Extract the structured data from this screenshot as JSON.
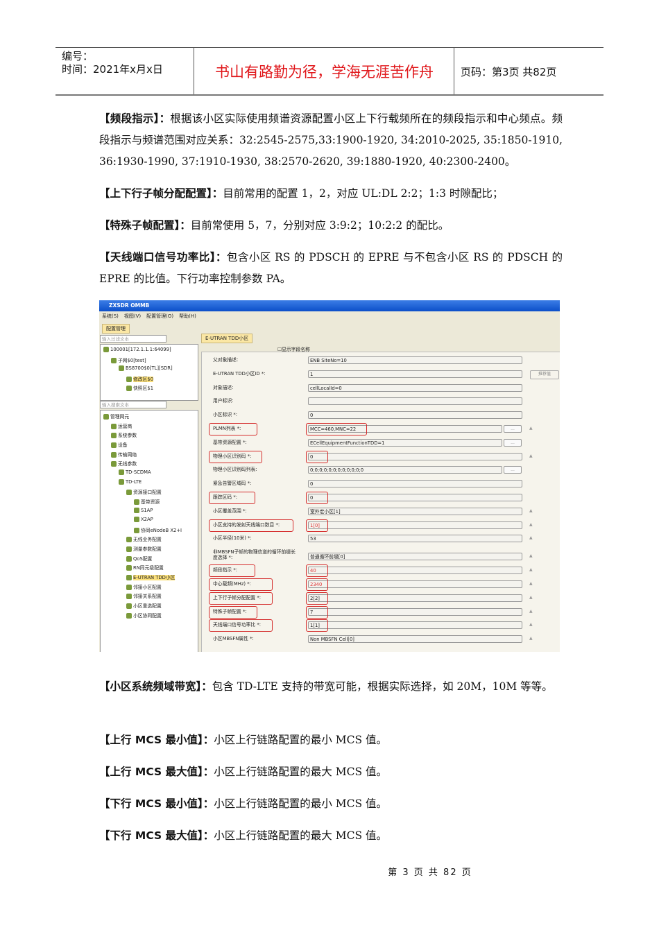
{
  "header": {
    "number_label": "编号：",
    "time_label": "时间：2021年x月x日",
    "motto": "书山有路勤为径，学海无涯苦作舟",
    "page_label": "页码：第3页 共82页"
  },
  "paragraphs": [
    {
      "title": "【频段指示】：",
      "body": "根据该小区实际使用频谱资源配置小区上下行载频所在的频段指示和中心频点。频段指示与频谱范围对应关系：32:2545-2575,33:1900-1920, 34:2010-2025, 35:1850-1910, 36:1930-1990, 37:1910-1930, 38:2570-2620, 39:1880-1920, 40:2300-2400。"
    },
    {
      "title": "【上下行子帧分配配置】：",
      "body": "目前常用的配置 1，2，对应 UL:DL 2:2；1:3 时隙配比；"
    },
    {
      "title": "【特殊子帧配置】：",
      "body": "目前常使用 5，7，分别对应 3:9:2；10:2:2 的配比。"
    },
    {
      "title": "【天线端口信号功率比】：",
      "body": "包含小区 RS 的 PDSCH 的 EPRE 与不包含小区 RS 的 PDSCH 的 EPRE 的比值。下行功率控制参数 PA。"
    },
    {
      "title": "【小区系统频域带宽】：",
      "body": "包含 TD-LTE 支持的带宽可能，根据实际选择，如 20M，10M 等等。"
    },
    {
      "title": "【上行 MCS 最小值】：",
      "body": "小区上行链路配置的最小 MCS 值。"
    },
    {
      "title": "【上行 MCS 最大值】：",
      "body": "小区上行链路配置的最大 MCS 值。"
    },
    {
      "title": "【下行 MCS 最小值】：",
      "body": "小区上行链路配置的最小 MCS 值。"
    },
    {
      "title": "【下行 MCS 最大值】：",
      "body": "小区上行链路配置的最大 MCS 值。"
    }
  ],
  "footer": "第 3 页 共 82 页",
  "screenshot": {
    "window_title": "ZXSDR OMMB",
    "menu": [
      "系统(S)",
      "视图(V)",
      "配置管理(O)",
      "帮助(H)"
    ],
    "left_tab": "配置管理",
    "filter_placeholder": "输入过滤文本",
    "search_placeholder": "输入搜索文本",
    "top_tree": [
      {
        "label": "100001[172.1.1.1:64099]",
        "indent": 0
      },
      {
        "label": "子网$0[test]",
        "indent": 1
      },
      {
        "label": "BS8700$0[TL][SDR]",
        "indent": 2
      },
      {
        "label": "修改区$0",
        "indent": 3,
        "selected": true
      },
      {
        "label": "快照区$1",
        "indent": 3
      }
    ],
    "bottom_tree": [
      {
        "label": "管理网元",
        "indent": 0
      },
      {
        "label": "运营商",
        "indent": 1
      },
      {
        "label": "系统参数",
        "indent": 1
      },
      {
        "label": "设备",
        "indent": 1
      },
      {
        "label": "传输网络",
        "indent": 1
      },
      {
        "label": "无线参数",
        "indent": 1
      },
      {
        "label": "TD-SCDMA",
        "indent": 2
      },
      {
        "label": "TD-LTE",
        "indent": 2
      },
      {
        "label": "资源接口配置",
        "indent": 3
      },
      {
        "label": "基带资源",
        "indent": 4
      },
      {
        "label": "S1AP",
        "indent": 4
      },
      {
        "label": "X2AP",
        "indent": 4
      },
      {
        "label": "协同eNodeB X2+I",
        "indent": 4
      },
      {
        "label": "无线业务配置",
        "indent": 3
      },
      {
        "label": "测量参数配置",
        "indent": 3
      },
      {
        "label": "QoS配置",
        "indent": 3
      },
      {
        "label": "RN同元级配置",
        "indent": 3
      },
      {
        "label": "E-UTRAN TDD小区",
        "indent": 3,
        "selected": true
      },
      {
        "label": "邻接小区配置",
        "indent": 3
      },
      {
        "label": "邻接关系配置",
        "indent": 3
      },
      {
        "label": "小区重选配置",
        "indent": 3
      },
      {
        "label": "小区协同配置",
        "indent": 3
      }
    ],
    "right_tab": "E-UTRAN TDD小区",
    "show_field_names": "显示字段名称",
    "recommend_button": "推荐值",
    "dots_label": "...",
    "rows": [
      {
        "label": "父对象描述:",
        "value": "ENB SiteNo=10"
      },
      {
        "label": "E-UTRAN TDD小区ID *:",
        "value": "1",
        "rec": true
      },
      {
        "label": "对象描述:",
        "value": "cellLocalId=0"
      },
      {
        "label": "用户标识:",
        "value": ""
      },
      {
        "label": "小区标识 *:",
        "value": "0"
      },
      {
        "label": "PLMN列表 *:",
        "value": "MCC=460,MNC=22",
        "hl": true,
        "btn": true,
        "arrow": true
      },
      {
        "label": "基带资源配置 *:",
        "value": "ECellEquipmentFunctionTDD=1",
        "btn": true
      },
      {
        "label": "物理小区识别码 *:",
        "value": "0",
        "hl": true,
        "arrow": true
      },
      {
        "label": "物理小区识别码列表:",
        "value": "0;0;0;0;0;0;0;0;0;0;0;0",
        "btn": true
      },
      {
        "label": "紧急告警区域码 *:",
        "value": "0"
      },
      {
        "label": "跟踪区码 *:",
        "value": "0",
        "hl": true
      },
      {
        "label": "小区覆盖范围 *:",
        "value": "室外宏小区[1]",
        "arrow": true
      },
      {
        "label": "小区支持的发射天线端口数目 *:",
        "value": "1[0]",
        "hl": true,
        "red": true,
        "arrow": true
      },
      {
        "label": "小区半径(10米) *:",
        "value": "53",
        "arrow": true
      },
      {
        "label": "非MBSFN子帧的物理信道的循环前缀长度选择 *:",
        "value": "普通循环前缀[0]",
        "arrow": true,
        "tall": true
      },
      {
        "label": "频段指示 *:",
        "value": "40",
        "hl": true,
        "red": true,
        "arrow": true
      },
      {
        "label": "中心载频(MHz) *:",
        "value": "2340",
        "hl": true,
        "red": true,
        "arrow": true
      },
      {
        "label": "上下行子帧分配配置 *:",
        "value": "2[2]",
        "hl": true,
        "arrow": true
      },
      {
        "label": "特殊子帧配置 *:",
        "value": "7",
        "hl": true,
        "arrow": true
      },
      {
        "label": "天线端口信号功率比 *:",
        "value": "1[1]",
        "hl": true,
        "arrow": true
      },
      {
        "label": "小区MBSFN属性 *:",
        "value": "Non MBSFN Cell[0]",
        "arrow": true
      }
    ]
  }
}
